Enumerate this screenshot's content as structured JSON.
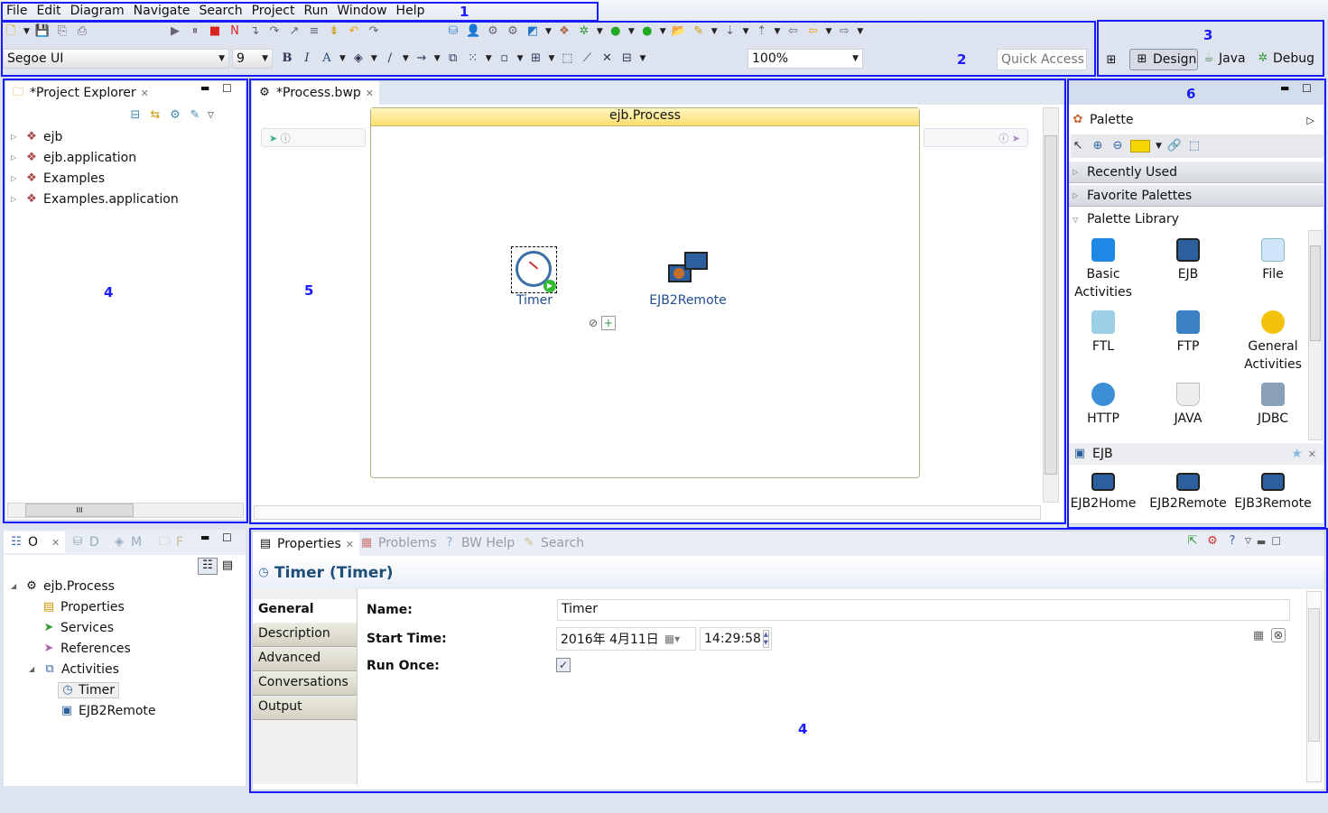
{
  "menu": [
    "File",
    "Edit",
    "Diagram",
    "Navigate",
    "Search",
    "Project",
    "Run",
    "Window",
    "Help"
  ],
  "toolbar": {
    "font_name": "Segoe UI",
    "font_size": "9",
    "zoom": "100%",
    "quick_access_placeholder": "Quick Access",
    "bold": "B",
    "italic": "I",
    "font_color": "A"
  },
  "perspectives": [
    "Design",
    "Java",
    "Debug"
  ],
  "annotations": {
    "a1": "1",
    "a2": "2",
    "a3": "3",
    "a4": "4",
    "a5": "5",
    "a6": "6",
    "a4b": "4"
  },
  "project_explorer": {
    "title": "*Project Explorer",
    "items": [
      "ejb",
      "ejb.application",
      "Examples",
      "Examples.application"
    ],
    "hscroll": "III"
  },
  "editor": {
    "tab": "*Process.bwp",
    "process_title": "ejb.Process",
    "activities": [
      {
        "label": "Timer"
      },
      {
        "label": "EJB2Remote"
      }
    ]
  },
  "palette": {
    "title": "Palette",
    "drawers": [
      "Recently Used",
      "Favorite Palettes",
      "Palette Library"
    ],
    "library": [
      "Basic Activities",
      "EJB",
      "File",
      "FTL",
      "FTP",
      "General Activities",
      "HTTP",
      "JAVA",
      "JDBC"
    ],
    "ejb_drawer": "EJB",
    "ejb_items": [
      "EJB2Home",
      "EJB2Remote",
      "EJB3Remote"
    ]
  },
  "outline": {
    "tabs": [
      "O",
      "D",
      "M",
      "F"
    ],
    "root": "ejb.Process",
    "items": [
      "Properties",
      "Services",
      "References",
      "Activities"
    ],
    "activities": [
      "Timer",
      "EJB2Remote"
    ]
  },
  "properties": {
    "tabs": [
      "Properties",
      "Problems",
      "BW Help",
      "Search"
    ],
    "title": "Timer (Timer)",
    "sections": [
      "General",
      "Description",
      "Advanced",
      "Conversations",
      "Output"
    ],
    "name_label": "Name:",
    "name_value": "Timer",
    "start_label": "Start Time:",
    "start_date": "2016年  4月11日",
    "start_time": "14:29:58",
    "run_once_label": "Run Once:",
    "run_once": true
  },
  "colors": {
    "annotation": "#1a1aff",
    "process_header": "#fde98a",
    "title_blue": "#1f4e79"
  }
}
